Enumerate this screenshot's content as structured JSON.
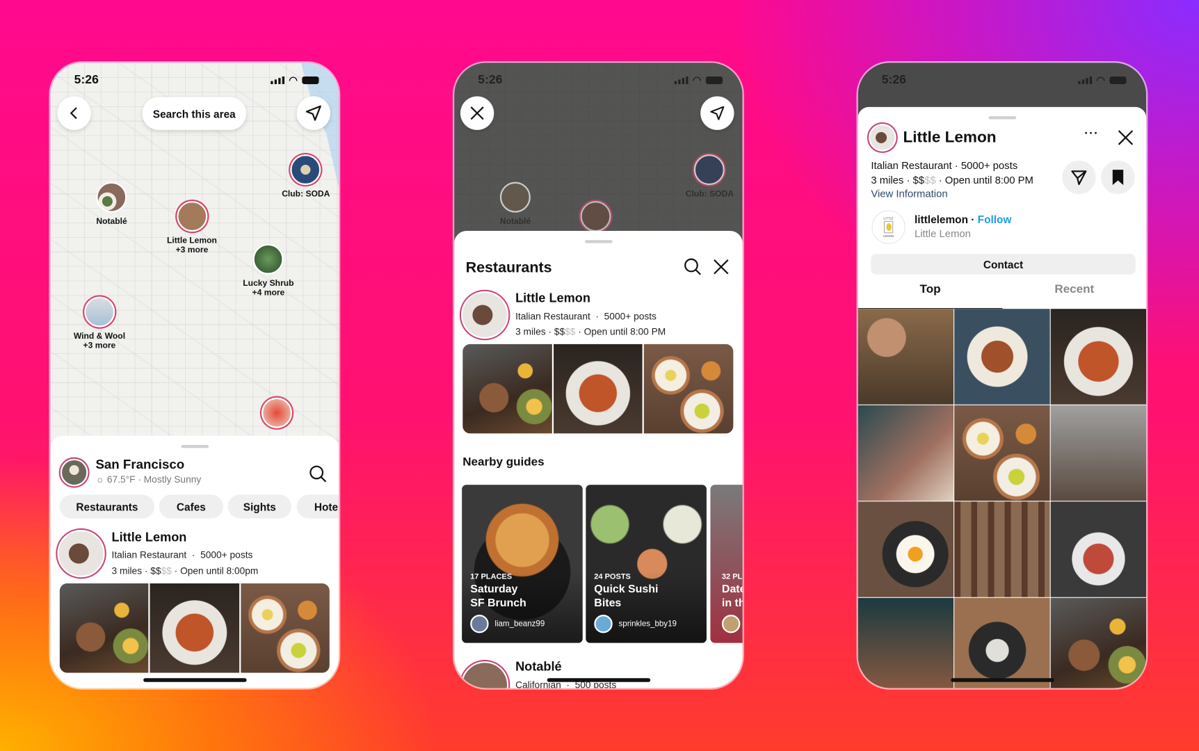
{
  "status_time": "5:26",
  "phone1": {
    "search_area_label": "Search this area",
    "pins": [
      {
        "name": "Notablé",
        "more": ""
      },
      {
        "name": "Little Lemon",
        "more": "+3 more"
      },
      {
        "name": "Club: SODA",
        "more": ""
      },
      {
        "name": "Lucky Shrub",
        "more": "+4 more"
      },
      {
        "name": "Wind & Wool",
        "more": "+3 more"
      }
    ],
    "city": "San Francisco",
    "weather": "67.5°F · Mostly Sunny",
    "chips": [
      "Restaurants",
      "Cafes",
      "Sights",
      "Hotels"
    ],
    "place": {
      "name": "Little Lemon",
      "category": "Italian Restaurant",
      "posts": "5000+ posts",
      "distance": "3 miles",
      "price_active": "$$",
      "price_inactive": "$$",
      "hours": "Open until 8:00pm"
    }
  },
  "phone2": {
    "map_pins": [
      "Notablé",
      "Club: SODA"
    ],
    "sheet_title": "Restaurants",
    "place": {
      "name": "Little Lemon",
      "category": "Italian Restaurant",
      "posts": "5000+ posts",
      "distance": "3 miles",
      "price_active": "$$",
      "price_inactive": "$$",
      "hours": "Open until 8:00 PM"
    },
    "guides_title": "Nearby guides",
    "guides": [
      {
        "count": "17 PLACES",
        "title1": "Saturday",
        "title2": "SF Brunch",
        "author": "liam_beanz99"
      },
      {
        "count": "24 POSTS",
        "title1": "Quick Sushi",
        "title2": "Bites",
        "author": "sprinkles_bby19"
      },
      {
        "count": "32 PL",
        "title1": "Date",
        "title2": "in th",
        "author": ""
      }
    ],
    "next_place": {
      "name": "Notablé",
      "category": "Californian",
      "posts": "500 posts"
    }
  },
  "phone3": {
    "title": "Little Lemon",
    "line1": "Italian Restaurant · 5000+ posts",
    "distance": "3 miles · ",
    "price_active": "$$",
    "price_inactive": "$$",
    "hours": " · Open until 8:00 PM",
    "view_info": "View Information",
    "account": "littlelemon",
    "follow": "Follow",
    "account_name": "Little Lemon",
    "logo_text_top": "LITTLE",
    "logo_text_bottom": "LEMON",
    "contact": "Contact",
    "tabs": [
      "Top",
      "Recent"
    ],
    "active_tab": "Top",
    "link_color": "#1a9ee6"
  }
}
